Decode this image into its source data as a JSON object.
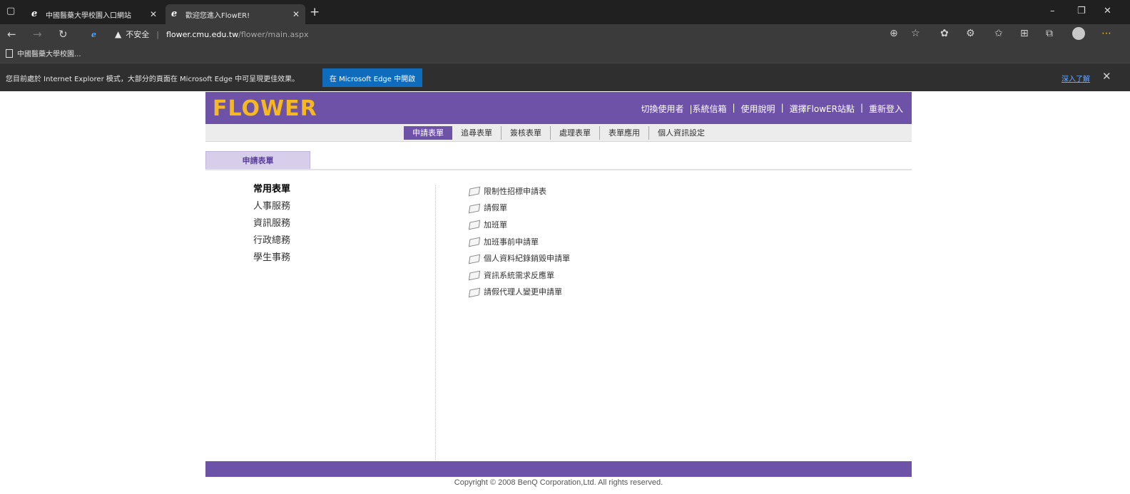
{
  "browser": {
    "tabs": [
      {
        "label": "中國醫藥大學校園入口網站"
      },
      {
        "label": "歡迎您進入FlowER!"
      }
    ],
    "address": {
      "security": "不安全",
      "host": "flower.cmu.edu.tw",
      "path": "/flower/main.aspx"
    },
    "favorites": [
      {
        "label": "中國醫藥大學校園..."
      }
    ],
    "ie_mode": {
      "message": "您目前處於 Internet Explorer 模式，大部分的頁面在 Microsoft Edge 中可呈現更佳效果。",
      "open_button": "在 Microsoft Edge 中開啟",
      "learn_more": "深入了解"
    }
  },
  "site": {
    "logo": "FLOWER",
    "top_links": [
      "切換使用者",
      "|系統信箱",
      "使用說明",
      "選擇FlowER站點",
      "重新登入"
    ],
    "menu": [
      "申請表單",
      "追尋表單",
      "簽核表單",
      "處理表單",
      "表單應用",
      "個人資訊設定"
    ],
    "active_menu": "申請表單",
    "section_tab": "申請表單",
    "categories": [
      "常用表單",
      "人事服務",
      "資訊服務",
      "行政總務",
      "學生事務"
    ],
    "forms": [
      "限制性招標申請表",
      "請假單",
      "加班單",
      "加班事前申請單",
      "個人資料紀錄銷毀申請單",
      "資訊系統需求反應單",
      "請假代理人變更申請單"
    ],
    "copyright": "Copyright © 2008 BenQ Corporation,Ltd. All rights reserved."
  },
  "colors": {
    "brand_purple": "#6e52a8",
    "logo_yellow": "#f5b820"
  }
}
